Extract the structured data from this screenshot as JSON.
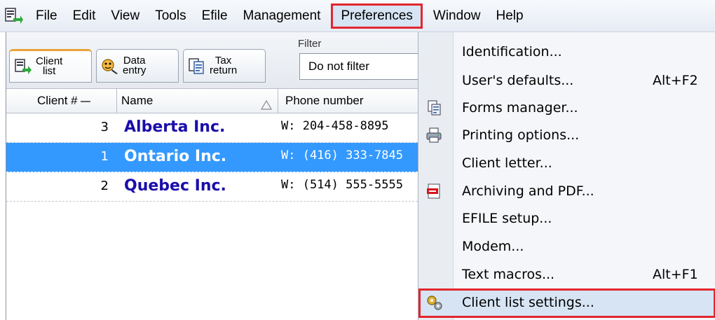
{
  "menubar": {
    "items": [
      {
        "label": "File"
      },
      {
        "label": "Edit"
      },
      {
        "label": "View"
      },
      {
        "label": "Tools"
      },
      {
        "label": "Efile"
      },
      {
        "label": "Management"
      },
      {
        "label": "Preferences",
        "state": "open"
      },
      {
        "label": "Window"
      },
      {
        "label": "Help"
      }
    ]
  },
  "tabs": [
    {
      "line1": "Client",
      "line2": "list",
      "icon": "client-list-icon",
      "active": true
    },
    {
      "line1": "Data",
      "line2": "entry",
      "icon": "data-entry-icon",
      "active": false
    },
    {
      "line1": "Tax",
      "line2": "return",
      "icon": "tax-return-icon",
      "active": false
    }
  ],
  "filter": {
    "label": "Filter",
    "value": "Do not filter"
  },
  "table": {
    "columns": [
      "Client #",
      "Name",
      "Phone number"
    ],
    "rows": [
      {
        "number": "3",
        "name": "Alberta Inc.",
        "phone": "W: 204-458-8895",
        "selected": false
      },
      {
        "number": "1",
        "name": "Ontario Inc.",
        "phone": "W: (416) 333-7845",
        "selected": true
      },
      {
        "number": "2",
        "name": "Quebec Inc.",
        "phone": "W: (514) 555-5555",
        "selected": false
      }
    ]
  },
  "preferences_menu": {
    "items": [
      {
        "label": "Identification...",
        "shortcut": "",
        "icon": ""
      },
      {
        "label": "User's defaults...",
        "shortcut": "Alt+F2",
        "icon": ""
      },
      {
        "label": "Forms manager...",
        "shortcut": "",
        "icon": "forms-manager-icon"
      },
      {
        "label": "Printing options...",
        "shortcut": "",
        "icon": "printer-icon"
      },
      {
        "label": "Client letter...",
        "shortcut": "",
        "icon": ""
      },
      {
        "label": "Archiving and PDF...",
        "shortcut": "",
        "icon": "pdf-icon"
      },
      {
        "label": "EFILE setup...",
        "shortcut": "",
        "icon": ""
      },
      {
        "label": "Modem...",
        "shortcut": "",
        "icon": ""
      },
      {
        "label": "Text macros...",
        "shortcut": "Alt+F1",
        "icon": ""
      },
      {
        "label": "Client list settings...",
        "shortcut": "",
        "icon": "settings-gears-icon",
        "highlighted": true
      }
    ]
  },
  "colors": {
    "highlight_border": "#e3262f",
    "selection": "#3399ff",
    "client_name": "#1a0dab",
    "active_tab_accent": "#e8a33a"
  }
}
